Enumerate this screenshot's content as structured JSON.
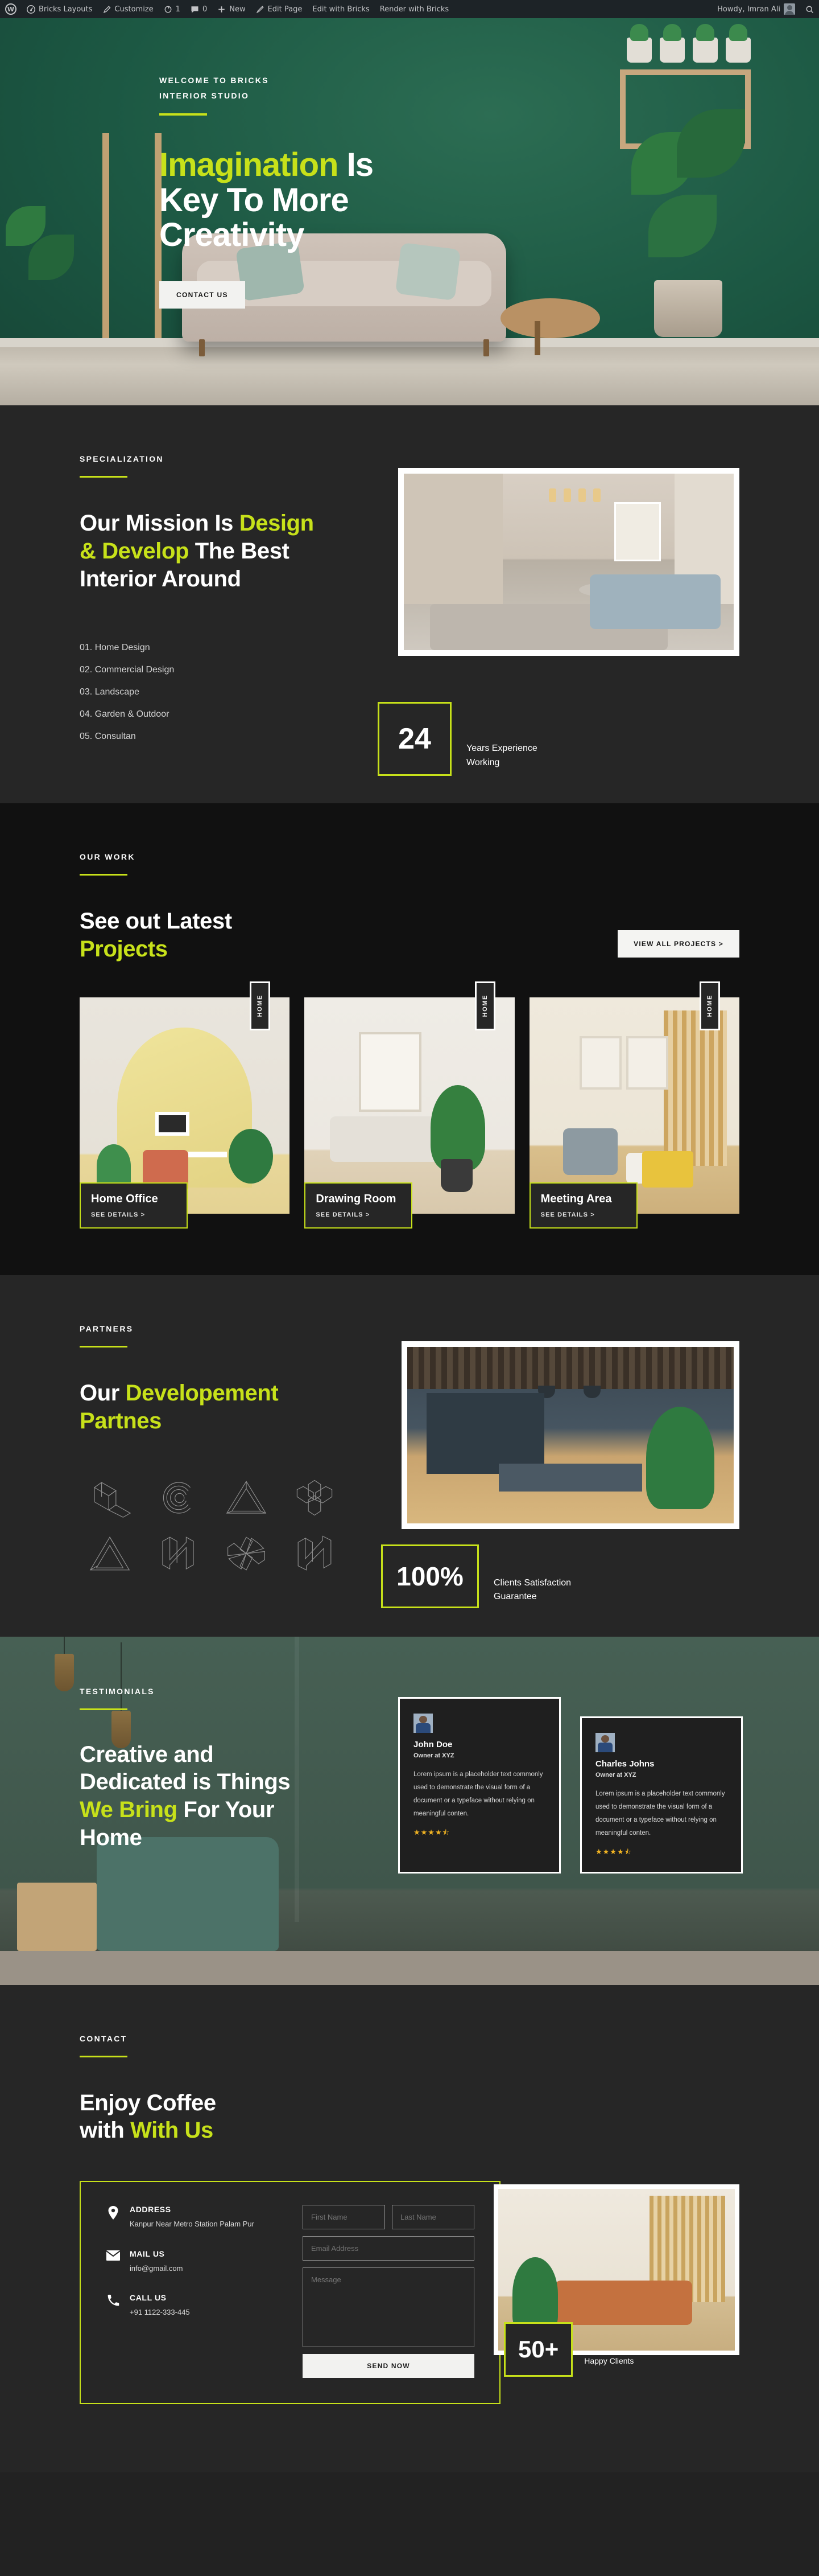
{
  "adminbar": {
    "left_items": [
      {
        "label": "",
        "icon": "wordpress-logo-icon"
      },
      {
        "label": "Bricks Layouts",
        "icon": "dashboard-icon"
      },
      {
        "label": "Customize",
        "icon": "brush-icon"
      },
      {
        "label": "1",
        "icon": "revisions-icon"
      },
      {
        "label": "0",
        "icon": "comment-icon"
      },
      {
        "label": "New",
        "icon": "plus-icon"
      },
      {
        "label": "Edit Page",
        "icon": "pencil-icon"
      },
      {
        "label": "Edit with Bricks",
        "icon": ""
      },
      {
        "label": "Render with Bricks",
        "icon": ""
      }
    ],
    "howdy": "Howdy, Imran Ali",
    "search_icon": "search-icon"
  },
  "hero": {
    "eyebrow_line1": "WELCOME TO BRICKS",
    "eyebrow_line2": "INTERIOR STUDIO",
    "heading_accent": "Imagination",
    "heading_rest_1": " Is",
    "heading_line2": "Key To More",
    "heading_line3": "Creativity",
    "cta": "CONTACT US"
  },
  "mission": {
    "eyebrow": "SPECIALIZATION",
    "h_part1": "Our Mission Is ",
    "h_accent1": "Design",
    "h_accent2": "& Develop",
    "h_part2": " The Best",
    "h_part3": "Interior Around",
    "list": [
      "01. Home Design",
      "02. Commercial Design",
      "03. Landscape",
      "04. Garden & Outdoor",
      "05. Consultan"
    ],
    "stat_number": "24",
    "stat_label": "Years Experience Working"
  },
  "work": {
    "eyebrow": "OUR WORK",
    "h_line1": "See out Latest",
    "h_accent": "Projects",
    "view_all": "VIEW ALL PROJECTS >",
    "cards": [
      {
        "tag": "HOME",
        "title": "Home Office",
        "details": "SEE DETAILS >"
      },
      {
        "tag": "HOME",
        "title": "Drawing Room",
        "details": "SEE DETAILS >"
      },
      {
        "tag": "HOME",
        "title": "Meeting Area",
        "details": "SEE DETAILS >"
      }
    ]
  },
  "partners": {
    "eyebrow": "PARTNERS",
    "h_part1": "Our ",
    "h_accent1": "Developement",
    "h_accent2": "Partnes",
    "logos": [
      "arrow-loop-logo",
      "spiral-c-logo",
      "penrose-triangle-logo",
      "hex-star-logo",
      "penrose-triangle-2-logo",
      "iso-n-logo",
      "pinwheel-logo",
      "iso-n-2-logo"
    ],
    "stat_number": "100%",
    "stat_label": "Clients Satisfaction Guarantee"
  },
  "testimonials": {
    "eyebrow": "TESTIMONIALS",
    "h_line1": "Creative and",
    "h_line2": "Dedicated is Things",
    "h_accent": "We Bring",
    "h_line3b": " For Your",
    "h_line4": "Home",
    "cards": [
      {
        "avatar": "avatar-john",
        "name": "John Doe",
        "role": "Owner at XYZ",
        "text": "Lorem ipsum is a placeholder text commonly used to demonstrate the visual form of a document or a typeface without relying on meaningful conten.",
        "stars": "★★★★⯪"
      },
      {
        "avatar": "avatar-charles",
        "name": "Charles Johns",
        "role": "Owner at XYZ",
        "text": "Lorem ipsum is a placeholder text commonly used to demonstrate the visual form of a document or a typeface without relying on meaningful conten.",
        "stars": "★★★★⯪"
      }
    ]
  },
  "contact": {
    "eyebrow": "CONTACT",
    "h_line1": "Enjoy Coffee",
    "h_line2a": "with ",
    "h_accent": "With Us",
    "info": [
      {
        "icon": "location-pin-icon",
        "label": "ADDRESS",
        "value": "Kanpur Near Metro Station Palam Pur"
      },
      {
        "icon": "envelope-icon",
        "label": "MAIL US",
        "value": "info@gmail.com"
      },
      {
        "icon": "phone-icon",
        "label": "CALL US",
        "value": "+91 1122-333-445"
      }
    ],
    "form": {
      "first_name_placeholder": "First Name",
      "last_name_placeholder": "Last Name",
      "email_placeholder": "Email Address",
      "message_placeholder": "Message",
      "submit": "SEND NOW"
    },
    "stat_number": "50+",
    "stat_label": "Happy Clients"
  },
  "colors": {
    "accent": "#c7e11a",
    "dark": "#262626",
    "darker": "#111111",
    "hero_green": "#1d5c45",
    "star": "#f0b323"
  }
}
